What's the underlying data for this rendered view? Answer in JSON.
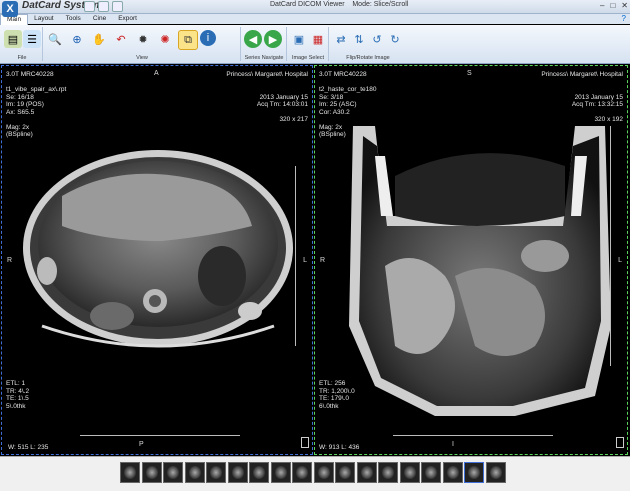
{
  "brand": {
    "name": "DatCard Systems",
    "logo_glyph": "X"
  },
  "window": {
    "title": "DatCard DICOM Viewer",
    "mode": "Mode: Slice/Scroll",
    "minimize": "–",
    "maximize": "□",
    "close": "✕"
  },
  "menu": {
    "items": [
      "Main",
      "Layout",
      "Tools",
      "Cine",
      "Export"
    ],
    "active": "Main",
    "help": "?"
  },
  "ribbon": {
    "groups": [
      {
        "label": "File"
      },
      {
        "label": "View"
      },
      {
        "label": "Series Navigate"
      },
      {
        "label": "Image Select"
      },
      {
        "label": "Flip/Rotate Image"
      }
    ]
  },
  "viewport_left": {
    "top_left": [
      "3.0T MRC40228",
      "",
      "t1_vibe_spair_ax\\.rpt",
      "Se: 16/18",
      "Im: 19 (POS)",
      "Ax: S65.5",
      "",
      "Mag: 2x",
      "(BSpline)"
    ],
    "top_right": [
      "Princess\\ Margaret\\ Hospital",
      "",
      "",
      "2013 January 15",
      "Acq Tm: 14:03:01",
      "",
      "320 x 217"
    ],
    "bottom_left": [
      "ETL: 1",
      "TR: 4\\.2",
      "TE: 1\\.5",
      "5\\.0thk"
    ],
    "wl": "W: 515 L: 235",
    "orient_top": "A",
    "orient_left": "R",
    "orient_right": "L",
    "orient_bottom": "P"
  },
  "viewport_right": {
    "top_left": [
      "3.0T MRC40228",
      "",
      "t2_haste_cor_te180",
      "Se: 3/18",
      "Im: 25 (ASC)",
      "Cor: A30.2",
      "",
      "Mag: 2x",
      "(BSpline)"
    ],
    "top_right": [
      "Princess\\ Margaret\\ Hospital",
      "",
      "",
      "2013 January 15",
      "Acq Tm: 13:32:15",
      "",
      "320 x 192"
    ],
    "bottom_left": [
      "ETL: 256",
      "TR: 1,200\\.0",
      "TE: 179\\.0",
      "6\\.0thk"
    ],
    "wl": "W: 913 L: 436",
    "orient_top": "S",
    "orient_left": "R",
    "orient_right": "L",
    "orient_bottom": "I"
  },
  "thumbnails": {
    "count": 18,
    "selected_index": 16
  },
  "colors": {
    "active_viewport_border": "#3f6fd6",
    "secondary_viewport_border": "#5bd45b",
    "ribbon_selected": "#fbe38a"
  }
}
